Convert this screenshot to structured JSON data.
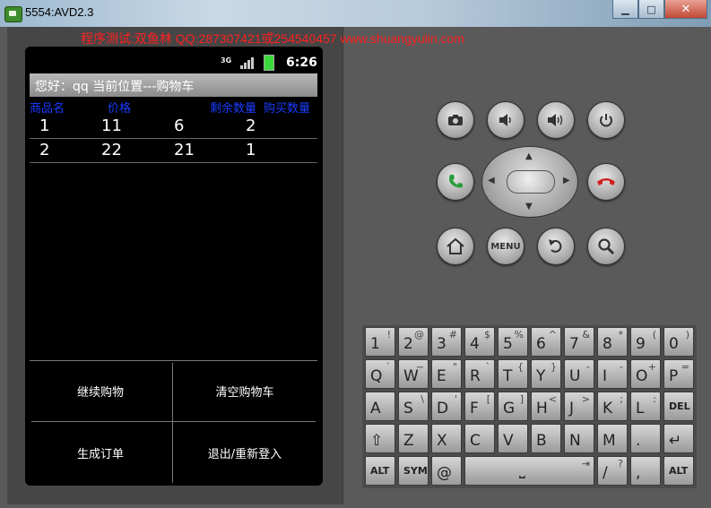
{
  "window": {
    "title": "5554:AVD2.3"
  },
  "banner": "程序测试:双鱼林 QQ:287307421或254540457 www.shuangyulin.com",
  "statusbar": {
    "network": "3G",
    "time": "6:26"
  },
  "appbar": {
    "title": "您好：qq   当前位置---购物车"
  },
  "table": {
    "headers": [
      "商品名",
      "价格",
      "剩余数量",
      "购买数量"
    ],
    "rows": [
      [
        "1",
        "11",
        "6",
        "2"
      ],
      [
        "2",
        "22",
        "21",
        "1"
      ]
    ]
  },
  "menu": {
    "continue": "继续购物",
    "clear": "清空购物车",
    "order": "生成订单",
    "logout": "退出/重新登入"
  },
  "hw_buttons": {
    "camera": "camera-icon",
    "vol_down": "volume-down-icon",
    "vol_up": "volume-up-icon",
    "power": "power-icon",
    "call": "call-icon",
    "end": "end-call-icon",
    "home": "home-icon",
    "menu": "MENU",
    "back": "back-icon",
    "search": "search-icon"
  },
  "keyboard": {
    "row1": [
      [
        "1",
        "!"
      ],
      [
        "2",
        "@"
      ],
      [
        "3",
        "#"
      ],
      [
        "4",
        "$"
      ],
      [
        "5",
        "%"
      ],
      [
        "6",
        "^"
      ],
      [
        "7",
        "&"
      ],
      [
        "8",
        "*"
      ],
      [
        "9",
        "("
      ],
      [
        "0",
        ")"
      ]
    ],
    "row2": [
      [
        "Q",
        "`"
      ],
      [
        "W",
        "~"
      ],
      [
        "E",
        "\""
      ],
      [
        "R",
        "`"
      ],
      [
        "T",
        "{"
      ],
      [
        "Y",
        "}"
      ],
      [
        "U",
        "-"
      ],
      [
        "I",
        "-"
      ],
      [
        "O",
        "+"
      ],
      [
        "P",
        "="
      ]
    ],
    "row3": [
      [
        "A",
        ""
      ],
      [
        "S",
        "\\"
      ],
      [
        "D",
        "'"
      ],
      [
        "F",
        "["
      ],
      [
        "G",
        "]"
      ],
      [
        "H",
        "<"
      ],
      [
        "J",
        ">"
      ],
      [
        "K",
        ";"
      ],
      [
        "L",
        ":"
      ],
      [
        "DEL",
        ""
      ]
    ],
    "row4": [
      [
        "⇧",
        ""
      ],
      [
        "Z",
        ""
      ],
      [
        "X",
        ""
      ],
      [
        "C",
        ""
      ],
      [
        "V",
        ""
      ],
      [
        "B",
        ""
      ],
      [
        "N",
        ""
      ],
      [
        "M",
        ""
      ],
      [
        ".",
        ""
      ],
      [
        "↵",
        ""
      ]
    ],
    "row5": {
      "alt": "ALT",
      "sym": "SYM",
      "at": "@",
      "slash": "/",
      "question": "?",
      "comma": ",",
      "alt2": "ALT"
    }
  }
}
